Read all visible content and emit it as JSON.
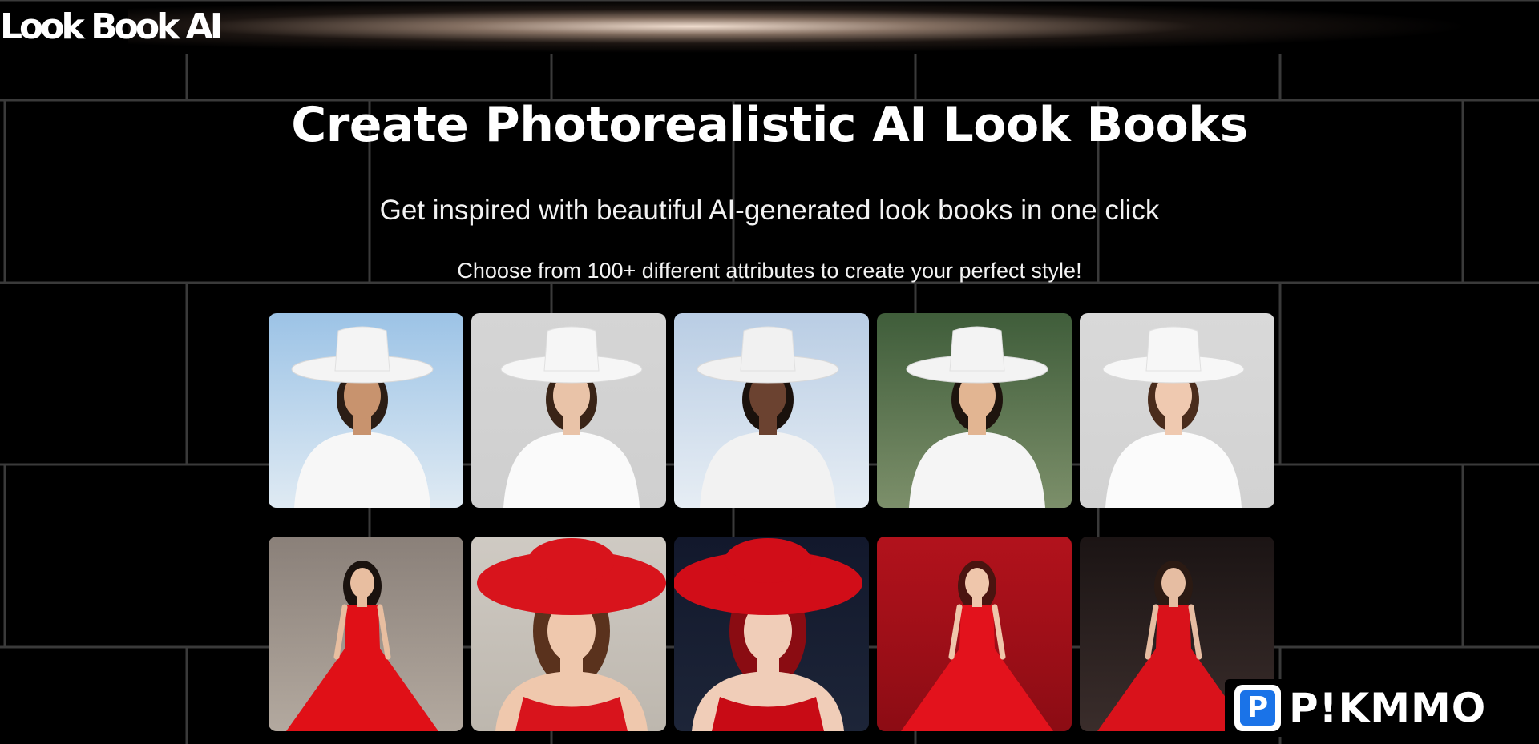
{
  "brand": {
    "logo_text": "Look Book AI"
  },
  "hero": {
    "title": "Create Photorealistic AI Look Books",
    "subtitle": "Get inspired with beautiful AI-generated look books in one click",
    "tagline": "Choose from 100+ different attributes to create your perfect style!"
  },
  "gallery": {
    "rows": [
      {
        "theme": "white hat outfits",
        "items": [
          {
            "name": "lookbook-photo-white-1",
            "bg_top": "#9cc3e6",
            "bg_bottom": "#dfeaf3",
            "hat": "#f4f4f4",
            "outfit": "#f7f7f7",
            "skin": "#c8936e",
            "hair": "#2b1d15"
          },
          {
            "name": "lookbook-photo-white-2",
            "bg_top": "#d5d5d5",
            "bg_bottom": "#cfcfcf",
            "hat": "#f6f6f6",
            "outfit": "#fafafa",
            "skin": "#e9c3a8",
            "hair": "#3a2417"
          },
          {
            "name": "lookbook-photo-white-3",
            "bg_top": "#b9cde4",
            "bg_bottom": "#e6edf4",
            "hat": "#f1f1f1",
            "outfit": "#f2f2f2",
            "skin": "#6b4230",
            "hair": "#1a110c"
          },
          {
            "name": "lookbook-photo-white-4",
            "bg_top": "#3f5d3a",
            "bg_bottom": "#7c8f6a",
            "hat": "#f3f3f3",
            "outfit": "#f5f5f5",
            "skin": "#e2b592",
            "hair": "#1e140e"
          },
          {
            "name": "lookbook-photo-white-5",
            "bg_top": "#d9d9d9",
            "bg_bottom": "#d2d2d2",
            "hat": "#f7f7f7",
            "outfit": "#fbfbfb",
            "skin": "#efc9b0",
            "hair": "#4a2c1c"
          }
        ]
      },
      {
        "theme": "red dress outfits",
        "items": [
          {
            "name": "lookbook-photo-red-1",
            "bg_top": "#8a8079",
            "bg_bottom": "#b3a99f",
            "hat": "",
            "outfit": "#e01017",
            "skin": "#e8bea0",
            "hair": "#1a120e"
          },
          {
            "name": "lookbook-photo-red-2",
            "bg_top": "#cfcac3",
            "bg_bottom": "#bdb7ae",
            "hat": "#d8141c",
            "outfit": "#d8141c",
            "skin": "#efc8ad",
            "hair": "#5a321d"
          },
          {
            "name": "lookbook-photo-red-3",
            "bg_top": "#12182c",
            "bg_bottom": "#1d2538",
            "hat": "#d10d18",
            "outfit": "#c80b15",
            "skin": "#f0cdb8",
            "hair": "#8a0c12"
          },
          {
            "name": "lookbook-photo-red-4",
            "bg_top": "#b2121c",
            "bg_bottom": "#8c0c14",
            "hat": "",
            "outfit": "#e3121c",
            "skin": "#efc6ab",
            "hair": "#4a1410"
          },
          {
            "name": "lookbook-photo-red-5",
            "bg_top": "#1b1414",
            "bg_bottom": "#3a2d2b",
            "hat": "",
            "outfit": "#d9121b",
            "skin": "#e6bda2",
            "hair": "#2b1a13"
          }
        ]
      }
    ]
  },
  "watermark": {
    "badge_letter": "P",
    "text": "P!KMMO"
  },
  "colors": {
    "background": "#000000",
    "grid_line": "#3a3a3a",
    "text": "#ffffff"
  }
}
